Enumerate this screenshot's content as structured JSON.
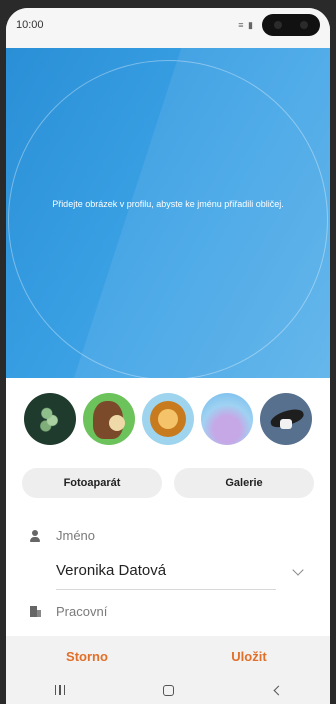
{
  "status_bar": {
    "time": "10:00",
    "icons": "≡ ▮"
  },
  "hero": {
    "hint_text": "Přidejte obrázek v profilu, abyste ke jménu přiřadili obličej."
  },
  "avatars": [
    {
      "icon": "plant-avatar"
    },
    {
      "icon": "horse-avatar"
    },
    {
      "icon": "lion-avatar"
    },
    {
      "icon": "gradient-avatar"
    },
    {
      "icon": "bird-avatar"
    }
  ],
  "buttons": {
    "camera": "Fotoaparát",
    "gallery": "Galerie"
  },
  "form": {
    "name_label": "Jméno",
    "name_value": "Veronika Datová",
    "work_label": "Pracovní"
  },
  "actions": {
    "cancel": "Storno",
    "save": "Uložit"
  },
  "colors": {
    "accent": "#e0702a",
    "hero_blue": "#2a8fd6"
  }
}
